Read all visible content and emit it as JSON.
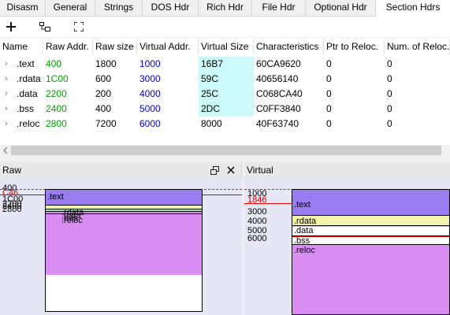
{
  "tabs": [
    {
      "label": "Disasm",
      "active": false
    },
    {
      "label": "General",
      "active": false
    },
    {
      "label": "Strings",
      "active": false
    },
    {
      "label": "DOS Hdr",
      "active": false
    },
    {
      "label": "Rich Hdr",
      "active": false
    },
    {
      "label": "File Hdr",
      "active": false
    },
    {
      "label": "Optional Hdr",
      "active": false
    },
    {
      "label": "Section Hdrs",
      "active": true
    }
  ],
  "toolbar": {
    "icons": [
      "plus-icon",
      "add-section-icon",
      "fit-icon"
    ]
  },
  "table": {
    "columns": [
      "Name",
      "Raw Addr.",
      "Raw size",
      "Virtual Addr.",
      "Virtual Size",
      "Characteristics",
      "Ptr to Reloc.",
      "Num. of Reloc."
    ],
    "rows": [
      {
        "name": ".text",
        "raw_addr": "400",
        "raw_size": "1800",
        "virt_addr": "1000",
        "virt_size": "16B7",
        "characteristics": "60CA9620",
        "ptr_reloc": "0",
        "num_reloc": "0"
      },
      {
        "name": ".rdata",
        "raw_addr": "1C00",
        "raw_size": "600",
        "virt_addr": "3000",
        "virt_size": "59C",
        "characteristics": "40656140",
        "ptr_reloc": "0",
        "num_reloc": "0"
      },
      {
        "name": ".data",
        "raw_addr": "2200",
        "raw_size": "200",
        "virt_addr": "4000",
        "virt_size": "25C",
        "characteristics": "C068CA40",
        "ptr_reloc": "0",
        "num_reloc": "0"
      },
      {
        "name": ".bss",
        "raw_addr": "2400",
        "raw_size": "400",
        "virt_addr": "5000",
        "virt_size": "2DC",
        "characteristics": "C0FF3840",
        "ptr_reloc": "0",
        "num_reloc": "0"
      },
      {
        "name": ".reloc",
        "raw_addr": "2800",
        "raw_size": "7200",
        "virt_addr": "6000",
        "virt_size": "8000",
        "characteristics": "40F63740",
        "ptr_reloc": "0",
        "num_reloc": "0"
      }
    ]
  },
  "raw_panel": {
    "title": "Raw",
    "axis_labels": [
      "400",
      "C46",
      "1C00",
      "2200",
      "2400",
      "2800"
    ],
    "sections": [
      ".text",
      ".rdata",
      ".data",
      ".bss",
      ".reloc"
    ]
  },
  "virtual_panel": {
    "title": "Virtual",
    "axis_labels": [
      "1000",
      "1846",
      "3000",
      "4000",
      "5000",
      "6000"
    ],
    "sections": [
      ".text",
      ".rdata",
      ".data",
      ".bss",
      ".reloc"
    ]
  },
  "colors": {
    "text_section": "#9a7cf0",
    "rdata_section": "#f2f2a8",
    "data_section": "#a8dca8",
    "reloc_section": "#d98cf2",
    "marker_line": "#e00000",
    "virtual_size_highlight": "#ccfafa",
    "raw_addr_text": "#00a000",
    "virtual_addr_text": "#0000e0"
  }
}
